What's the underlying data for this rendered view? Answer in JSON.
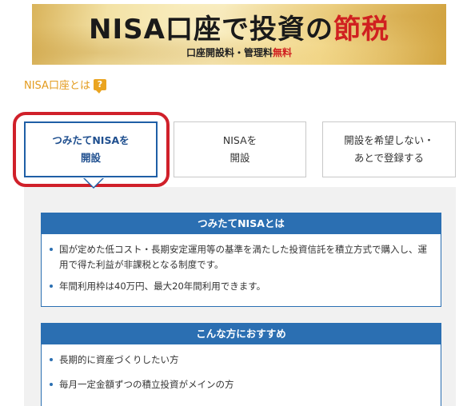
{
  "banner": {
    "title_part1": "NISA口座で投資の",
    "title_accent": "節税",
    "subtitle_part1": "口座開設料・管理料",
    "subtitle_free": "無料"
  },
  "whatis": {
    "label": "NISA口座とは",
    "help_glyph": "?"
  },
  "options": [
    {
      "label": "つみたてNISAを\n開設",
      "selected": true
    },
    {
      "label": "NISAを\n開設",
      "selected": false
    },
    {
      "label": "開設を希望しない・\nあとで登録する",
      "selected": false
    }
  ],
  "cards": [
    {
      "title": "つみたてNISAとは",
      "items": [
        "国が定めた低コスト・長期安定運用等の基準を満たした投資信託を積立方式で購入し、運用で得た利益が非課税となる制度です。",
        "年間利用枠は40万円、最大20年間利用できます。"
      ]
    },
    {
      "title": "こんな方におすすめ",
      "items": [
        "長期的に資産づくりしたい方",
        "毎月一定金額ずつの積立投資がメインの方"
      ]
    }
  ],
  "colors": {
    "primary_blue": "#2b6fb2",
    "highlight_red": "#d0202a",
    "link_orange": "#e39b1e"
  }
}
